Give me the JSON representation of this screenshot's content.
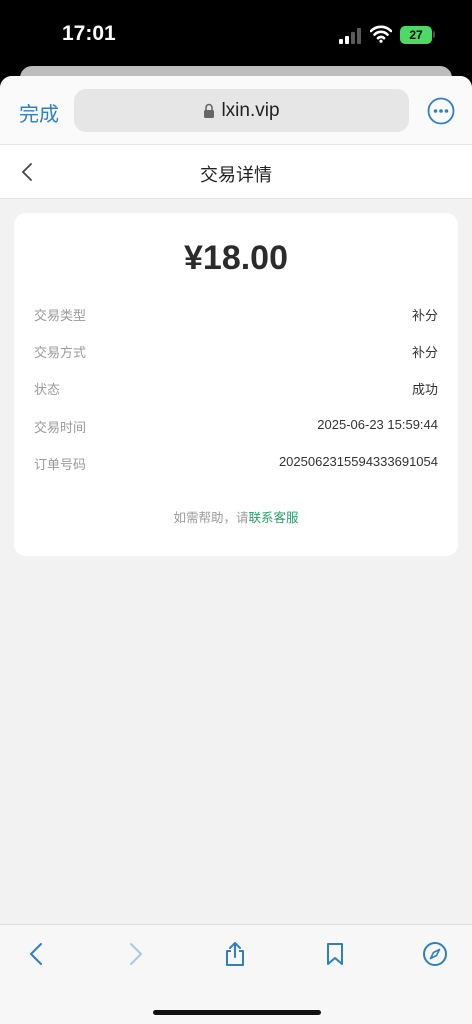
{
  "status_bar": {
    "time": "17:01",
    "battery": "27"
  },
  "browser": {
    "done_label": "完成",
    "url": "lxin.vip"
  },
  "header": {
    "title": "交易详情"
  },
  "transaction": {
    "amount": "¥18.00",
    "rows": [
      {
        "label": "交易类型",
        "value": "补分"
      },
      {
        "label": "交易方式",
        "value": "补分"
      },
      {
        "label": "状态",
        "value": "成功"
      },
      {
        "label": "交易时间",
        "value": "2025-06-23 15:59:44"
      },
      {
        "label": "订单号码",
        "value": "2025062315594333691054"
      }
    ]
  },
  "help": {
    "prefix": "如需帮助，请",
    "link": "联系客服"
  },
  "colors": {
    "accent": "#2f7fc1",
    "link": "#2a9d6e",
    "battery": "#4cd964"
  },
  "icons": {
    "browser": [
      "lock-icon",
      "more-icon"
    ],
    "header": [
      "chevron-left-icon"
    ],
    "toolbar": [
      "back-arrow-icon",
      "forward-arrow-icon",
      "share-icon",
      "bookmark-icon",
      "compass-icon"
    ]
  }
}
